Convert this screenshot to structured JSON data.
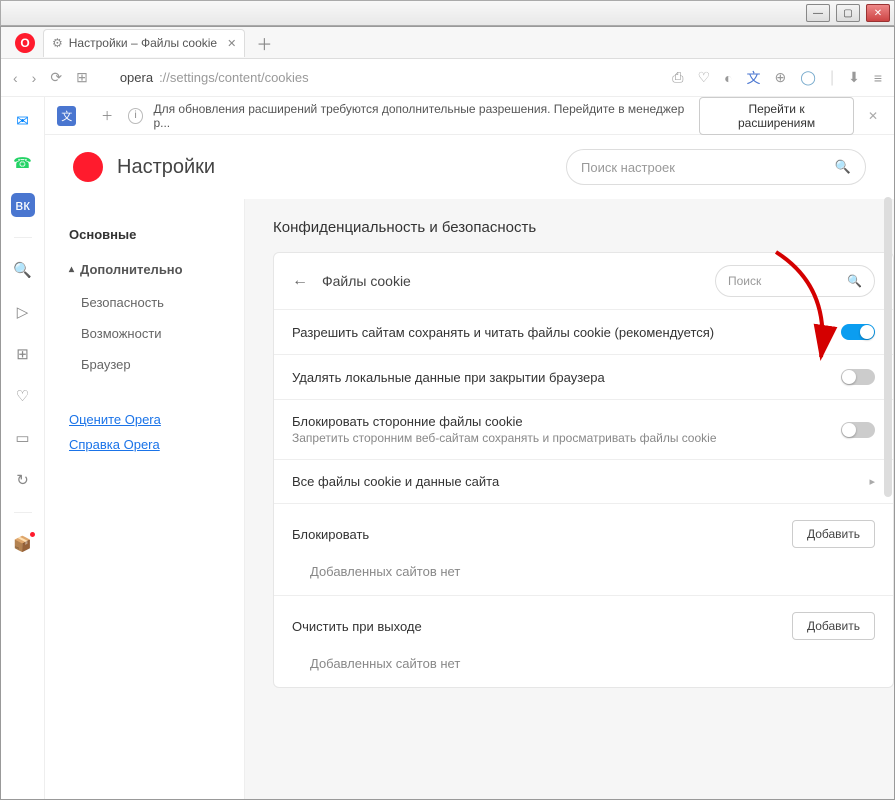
{
  "tab": {
    "title": "Настройки – Файлы cookie"
  },
  "address": {
    "host": "opera",
    "path": "://settings/content/cookies"
  },
  "promo": {
    "text": "Для обновления расширений требуются дополнительные разрешения. Перейдите в менеджер р...",
    "button": "Перейти к расширениям"
  },
  "header": {
    "title": "Настройки"
  },
  "search": {
    "placeholder": "Поиск настроек"
  },
  "sidebar": {
    "main": "Основные",
    "advanced": "Дополнительно",
    "security": "Безопасность",
    "features": "Возможности",
    "browser": "Браузер",
    "rate": "Оцените Opera",
    "help": "Справка Opera"
  },
  "section": {
    "title": "Конфиденциальность и безопасность"
  },
  "card": {
    "title": "Файлы cookie",
    "search_placeholder": "Поиск"
  },
  "rows": {
    "allow": "Разрешить сайтам сохранять и читать файлы cookie (рекомендуется)",
    "clear_on_exit": "Удалять локальные данные при закрытии браузера",
    "block3p_title": "Блокировать сторонние файлы cookie",
    "block3p_sub": "Запретить сторонним веб-сайтам сохранять и просматривать файлы cookie",
    "all_cookies": "Все файлы cookie и данные сайта"
  },
  "blocks": {
    "block_title": "Блокировать",
    "clear_title": "Очистить при выходе",
    "add_button": "Добавить",
    "empty": "Добавленных сайтов нет"
  }
}
